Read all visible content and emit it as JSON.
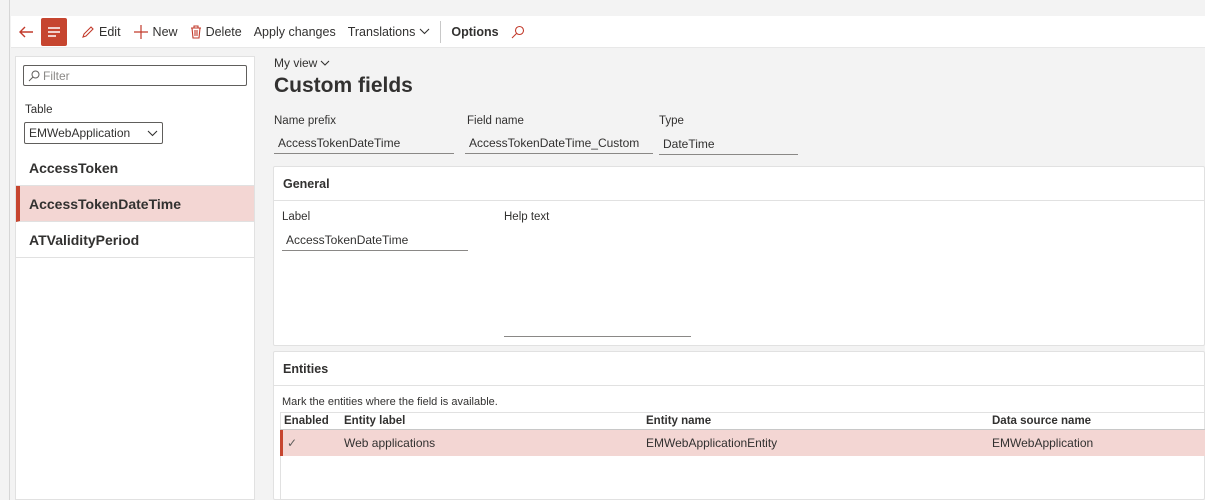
{
  "toolbar": {
    "edit": "Edit",
    "new": "New",
    "delete": "Delete",
    "apply": "Apply changes",
    "translations": "Translations",
    "options": "Options",
    "icons": [
      "back-arrow-icon",
      "menu-icon",
      "pencil-icon",
      "plus-icon",
      "trash-icon",
      "chevron-down-icon",
      "search-icon"
    ]
  },
  "list": {
    "filter_placeholder": "Filter",
    "table_label": "Table",
    "table_value": "EMWebApplication",
    "items": [
      {
        "label": "AccessToken",
        "selected": false
      },
      {
        "label": "AccessTokenDateTime",
        "selected": true
      },
      {
        "label": "ATValidityPeriod",
        "selected": false
      }
    ]
  },
  "header": {
    "view": "My view",
    "title": "Custom fields",
    "name_prefix_label": "Name prefix",
    "name_prefix_value": "AccessTokenDateTime",
    "field_name_label": "Field name",
    "field_name_value": "AccessTokenDateTime_Custom",
    "type_label": "Type",
    "type_value": "DateTime"
  },
  "general": {
    "title": "General",
    "label_label": "Label",
    "label_value": "AccessTokenDateTime",
    "help_label": "Help text",
    "help_value": ""
  },
  "entities": {
    "title": "Entities",
    "note": "Mark the entities where the field is available.",
    "columns": [
      "Enabled",
      "Entity label",
      "Entity name",
      "Data source name"
    ],
    "rows": [
      {
        "enabled": "✓",
        "label": "Web applications",
        "name": "EMWebApplicationEntity",
        "source": "EMWebApplication"
      }
    ]
  },
  "colors": {
    "accent": "#c6452f",
    "selection": "#f3d6d3"
  }
}
